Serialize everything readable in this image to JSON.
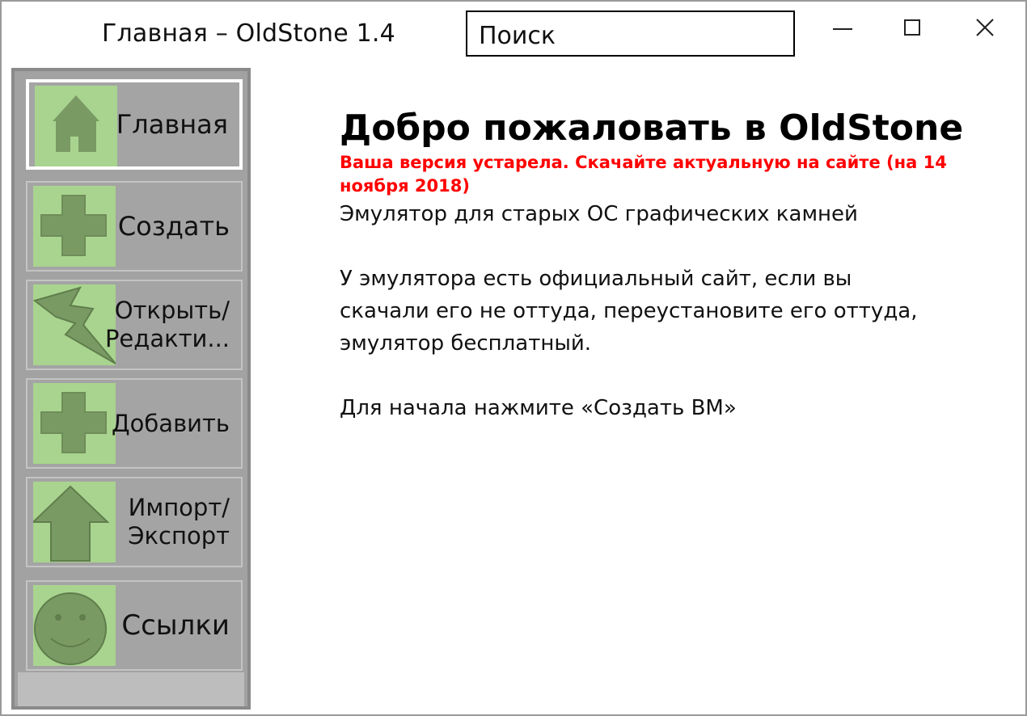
{
  "window": {
    "title": "Главная – OldStone 1.4",
    "controls": {
      "minimize_icon": "minimize-icon",
      "maximize_icon": "maximize-icon",
      "close_icon": "close-icon"
    }
  },
  "search": {
    "value": "Поиск"
  },
  "sidebar": {
    "items": [
      {
        "label": "Главная",
        "icon": "house-icon",
        "active": true
      },
      {
        "label": "Создать",
        "icon": "plus-icon",
        "active": false
      },
      {
        "label": "Открыть/\nРедакти...",
        "icon": "lightning-icon",
        "active": false
      },
      {
        "label": "Добавить",
        "icon": "plus-icon",
        "active": false
      },
      {
        "label": "Импорт/\nЭкспорт",
        "icon": "arrow-up-icon",
        "active": false
      },
      {
        "label": "Ссылки",
        "icon": "smiley-icon",
        "active": false
      }
    ]
  },
  "main": {
    "heading": "Добро пожаловать в OldStone",
    "warning": "Ваша версия устарела. Скачайте актуальную на сайте (на 14 ноября 2018)",
    "description": "Эмулятор для старых ОС графических камней",
    "notice": "У эмулятора есть официальный сайт, если вы скачали его не оттуда, переустановите его оттуда, эмулятор бесплатный.",
    "start_hint": "Для начала нажмите «Создать ВМ»"
  },
  "colors": {
    "icon_bg": "#a9d48f",
    "icon_fg": "#7a9a64",
    "sidebar_bg": "#a2a2a2",
    "warning": "#ff0000"
  }
}
